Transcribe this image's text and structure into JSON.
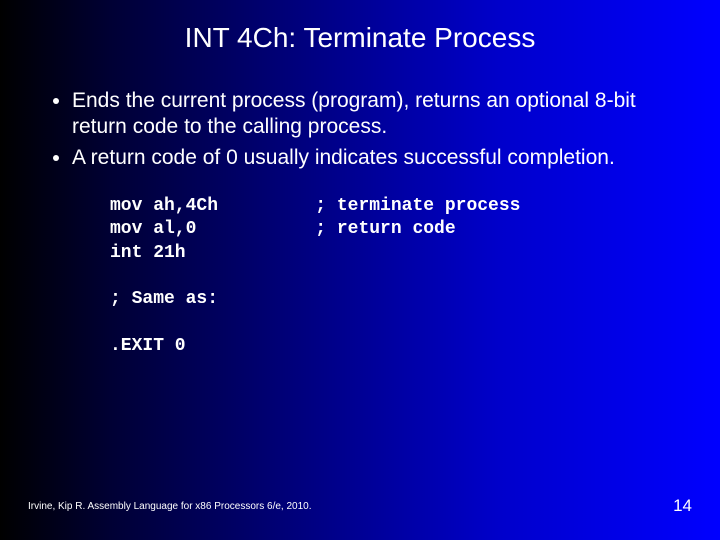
{
  "title": "INT 4Ch: Terminate Process",
  "bullets": [
    "Ends the current process (program), returns an optional 8-bit return code to the calling process.",
    "A return code of 0 usually indicates successful completion."
  ],
  "code": "mov ah,4Ch         ; terminate process\nmov al,0           ; return code\nint 21h\n\n; Same as:\n\n.EXIT 0",
  "footer": "Irvine, Kip R. Assembly Language for x86 Processors 6/e, 2010.",
  "page": "14"
}
